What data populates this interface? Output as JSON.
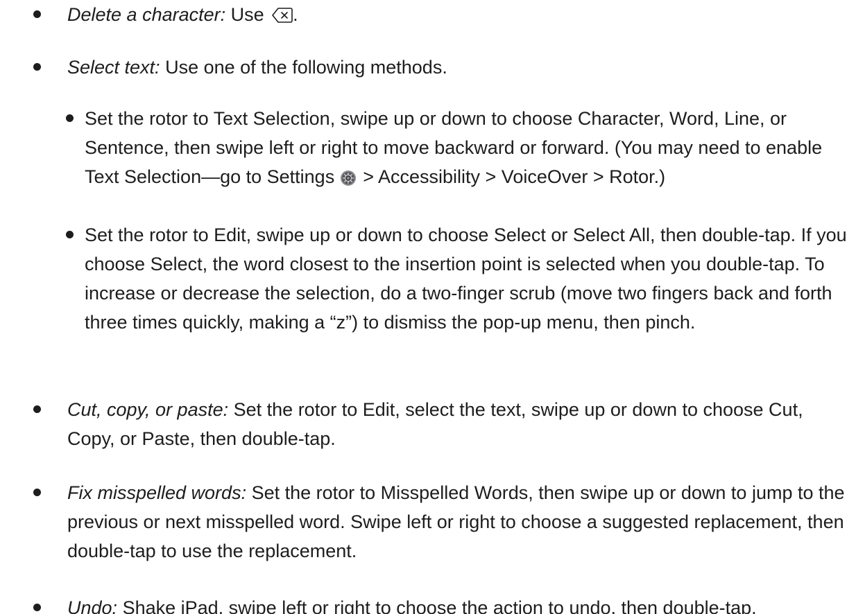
{
  "items": [
    {
      "term": "Delete a character:",
      "text": " Use ",
      "icon": "delete-key-icon",
      "after_icon": "."
    },
    {
      "term": "Select text:",
      "text": " Use one of the following methods."
    },
    {
      "sub": true,
      "text": "Set the rotor to Text Selection, swipe up or down to choose Character, Word, Line, or Sentence, then swipe left or right to move backward or forward. (You may need to enable Text Selection—go to Settings ",
      "icon": "settings-gear-icon",
      "after_icon": " > Accessibility > VoiceOver > Rotor.)"
    },
    {
      "sub": true,
      "text": "Set the rotor to Edit, swipe up or down to choose Select or Select All, then double-tap. If you choose Select, the word closest to the insertion point is selected when you double-tap. To increase or decrease the selection, do a two-finger scrub (move two fingers back and forth three times quickly, making a “z”) to dismiss the pop-up menu, then pinch."
    },
    {
      "term": "Cut, copy, or paste:",
      "text": " Set the rotor to Edit, select the text, swipe up or down to choose Cut, Copy, or Paste, then double-tap."
    },
    {
      "term": "Fix misspelled words:",
      "text": " Set the rotor to Misspelled Words, then swipe up or down to jump to the previous or next misspelled word. Swipe left or right to choose a suggested replacement, then double-tap to use the replacement."
    },
    {
      "term": "Undo:",
      "text": " Shake iPad, swipe left or right to choose the action to undo, then double-tap."
    }
  ]
}
